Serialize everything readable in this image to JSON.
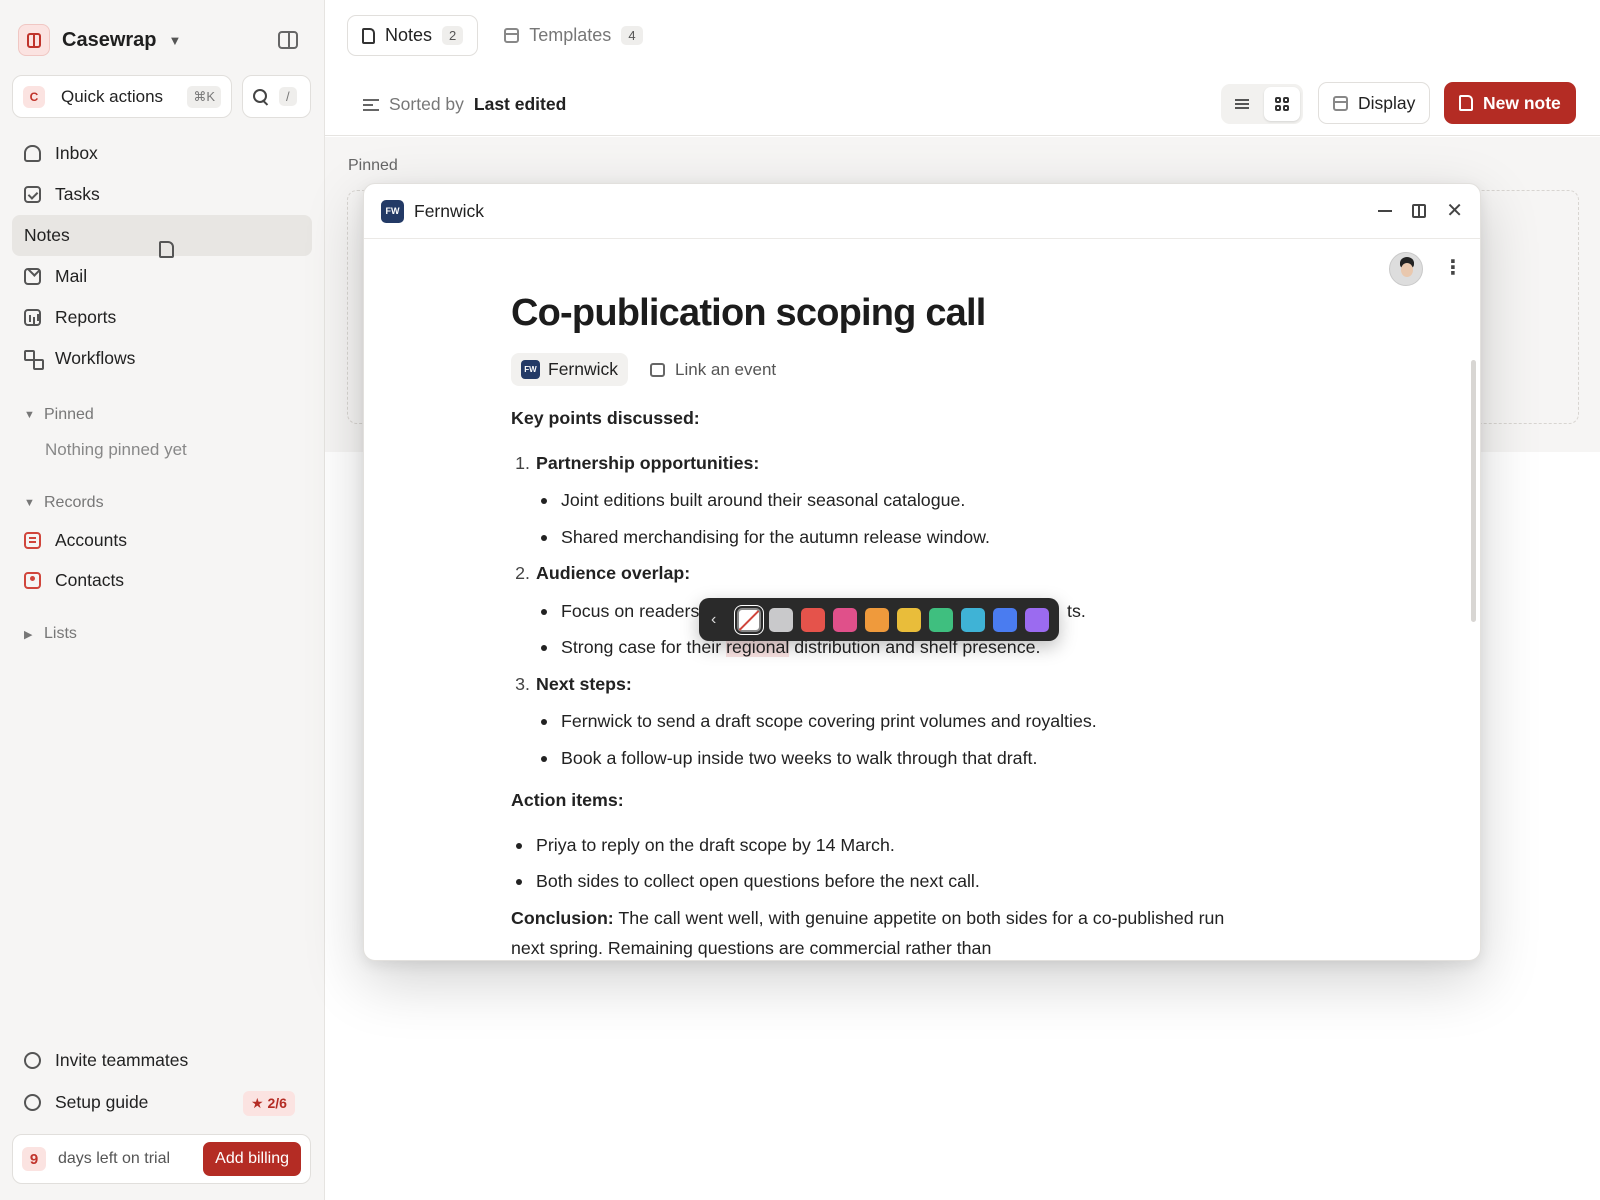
{
  "workspace": {
    "name": "Casewrap"
  },
  "quick_actions": {
    "badge": "C",
    "label": "Quick actions",
    "shortcut": "⌘K"
  },
  "search": {
    "shortcut": "/"
  },
  "nav": [
    {
      "label": "Inbox",
      "icon": "bell-icon"
    },
    {
      "label": "Tasks",
      "icon": "check-square-icon"
    },
    {
      "label": "Notes",
      "icon": "document-icon",
      "active": true
    },
    {
      "label": "Mail",
      "icon": "mail-icon"
    },
    {
      "label": "Reports",
      "icon": "chart-icon"
    },
    {
      "label": "Workflows",
      "icon": "workflow-icon"
    }
  ],
  "pinned_section": {
    "label": "Pinned",
    "empty": "Nothing pinned yet"
  },
  "records_section": {
    "label": "Records",
    "items": [
      {
        "label": "Accounts"
      },
      {
        "label": "Contacts"
      }
    ]
  },
  "lists_section": {
    "label": "Lists"
  },
  "footer": {
    "invite": "Invite teammates",
    "setup": "Setup guide",
    "setup_progress": "★ 2/6",
    "trial_days": "9",
    "trial_text": "days left on trial",
    "billing_button": "Add billing"
  },
  "tabs": [
    {
      "label": "Notes",
      "count": "2",
      "active": true
    },
    {
      "label": "Templates",
      "count": "4"
    }
  ],
  "toolbar": {
    "sorted_by_label": "Sorted by",
    "sorted_by_value": "Last edited",
    "display_label": "Display",
    "new_note_label": "New note"
  },
  "pinned_area": {
    "label": "Pinned"
  },
  "modal": {
    "company_badge": "FW",
    "company": "Fernwick",
    "title": "Co-publication scoping call",
    "company_tag": "Fernwick",
    "link_event": "Link an event",
    "key_points_heading": "Key points discussed:",
    "sections": [
      {
        "num": "1.",
        "heading": "Partnership opportunities:",
        "bullets": [
          "Joint editions built around their seasonal catalogue.",
          "Shared merchandising for the autumn release window."
        ]
      },
      {
        "num": "2.",
        "heading": "Audience overlap:",
        "bullet_a_start": "Focus on readers",
        "bullet_a_end": "ts.",
        "bullet_b_pre": "Strong case for their ",
        "bullet_b_hl": "regional",
        "bullet_b_post": " distribution and shelf presence."
      },
      {
        "num": "3.",
        "heading": "Next steps:",
        "bullets": [
          "Fernwick to send a draft scope covering print volumes and royalties.",
          "Book a follow-up inside two weeks to walk through that draft."
        ]
      }
    ],
    "action_items_heading": "Action items:",
    "action_items": [
      "Priya to reply on the draft scope by 14 March.",
      "Both sides to collect open questions before the next call."
    ],
    "conclusion_label": "Conclusion:",
    "conclusion_line1": " The call went well, with genuine appetite on both sides for a co-published run",
    "conclusion_line2": "next spring. Remaining questions are commercial rather than"
  },
  "color_picker": {
    "swatches": [
      {
        "name": "none",
        "color": "#ffffff"
      },
      {
        "name": "gray",
        "color": "#c9c9cb"
      },
      {
        "name": "red",
        "color": "#e5534b"
      },
      {
        "name": "pink",
        "color": "#e0508a"
      },
      {
        "name": "orange",
        "color": "#ef9a3c"
      },
      {
        "name": "yellow",
        "color": "#e9bd3a"
      },
      {
        "name": "green",
        "color": "#3fbf7f"
      },
      {
        "name": "cyan",
        "color": "#3fb3d6"
      },
      {
        "name": "blue",
        "color": "#4a7cf0"
      },
      {
        "name": "purple",
        "color": "#9b6bf0"
      }
    ]
  },
  "colors": {
    "accent": "#b42c24",
    "accent_soft": "#fbe3e1",
    "sidebar_bg": "#f6f5f4",
    "company_badge": "#233a66"
  }
}
